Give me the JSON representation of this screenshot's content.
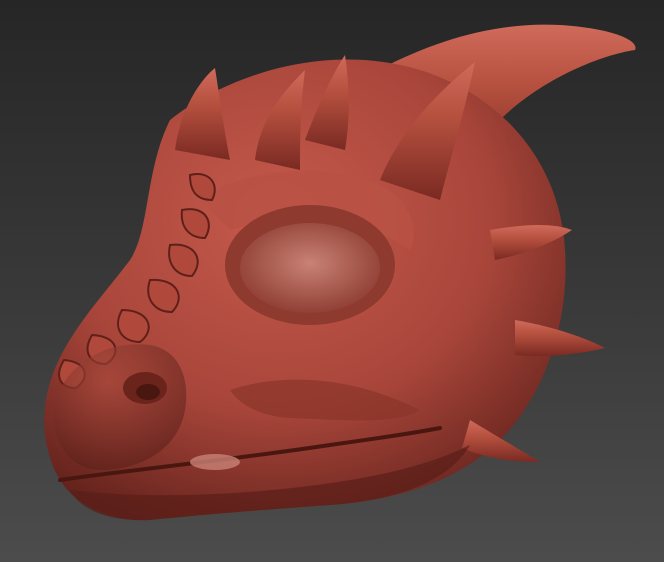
{
  "scene": {
    "subject": "dragon-head-sculpt",
    "material_color": "#a8453a",
    "shadow_color": "#5a1e18",
    "highlight_color": "#d9786a",
    "background_top": "#262626",
    "background_bottom": "#4c4c4c"
  }
}
